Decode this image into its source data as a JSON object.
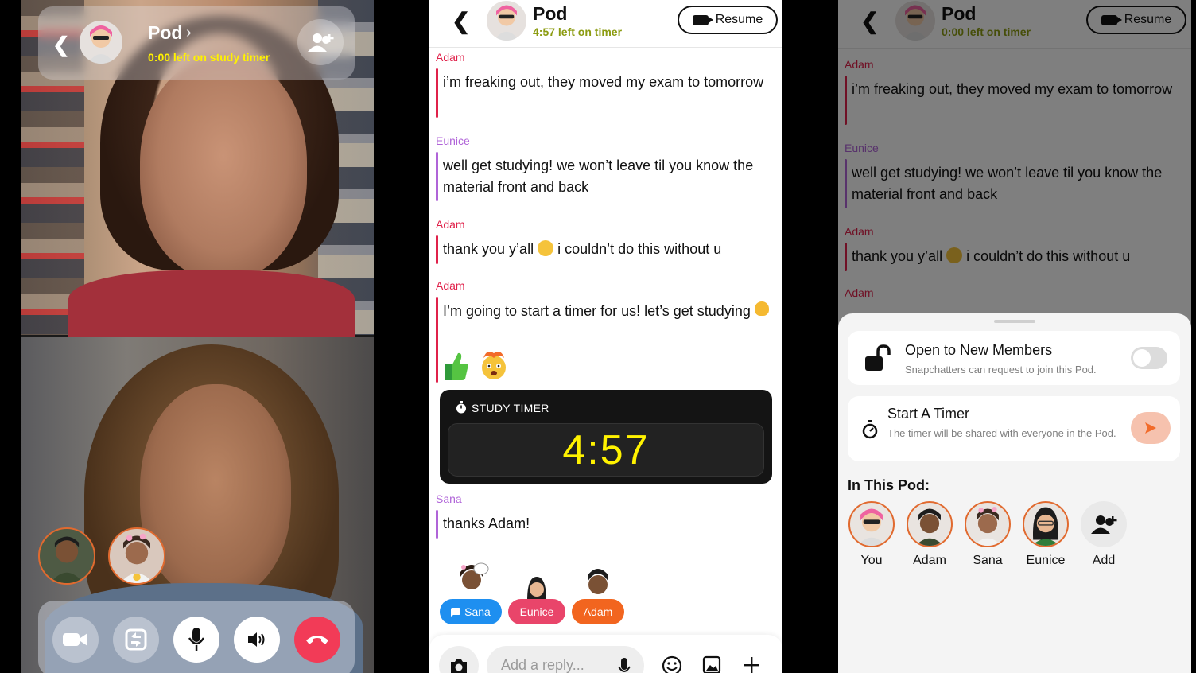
{
  "call": {
    "title": "Pod",
    "timer_text": "0:00 left on study timer"
  },
  "chat": {
    "title": "Pod",
    "timer_text": "4:57 left on timer",
    "resume_label": "Resume",
    "messages": [
      {
        "sender": "Adam",
        "text": "i’m freaking out, they moved my exam to tomorrow"
      },
      {
        "sender": "Eunice",
        "text": "well get studying! we won’t leave til you know the material front and back"
      },
      {
        "sender": "Adam",
        "text_before": "thank you y’all",
        "text_after": "i couldn’t do this without u"
      },
      {
        "sender": "Adam",
        "text": "I’m going to start a timer for us! let’s get studying"
      },
      {
        "sender": "Sana",
        "text": "thanks Adam!"
      }
    ],
    "timer_card": {
      "label": "STUDY TIMER",
      "value": "4:57"
    },
    "presence": [
      {
        "name": "Sana",
        "color": "#1e8ff0"
      },
      {
        "name": "Eunice",
        "color": "#e9456a"
      },
      {
        "name": "Adam",
        "color": "#f2651f"
      }
    ],
    "compose_placeholder": "Add a reply..."
  },
  "settings": {
    "title": "Pod",
    "timer_text": "0:00 left on timer",
    "resume_label": "Resume",
    "messages": [
      {
        "sender": "Adam",
        "text": "i’m freaking out, they moved my exam to tomorrow"
      },
      {
        "sender": "Eunice",
        "text": "well get studying! we won’t leave til you know the material front and back"
      },
      {
        "sender": "Adam",
        "text_before": "thank you y’all",
        "text_after": "i couldn’t do this without u"
      },
      {
        "sender": "Adam"
      }
    ],
    "open_members": {
      "title": "Open to New Members",
      "desc": "Snapchatters can request to join this Pod.",
      "enabled": false
    },
    "start_timer": {
      "title": "Start A Timer",
      "desc": "The timer will be shared with everyone in the Pod."
    },
    "in_pod_label": "In This Pod:",
    "members": [
      "You",
      "Adam",
      "Sana",
      "Eunice"
    ],
    "add_label": "Add"
  },
  "colors": {
    "timer_yellow": "#fff200",
    "adam": "#e0214a",
    "eunice": "#b064d8",
    "hangup": "#f23b57",
    "accent_orange": "#e16a2f"
  }
}
